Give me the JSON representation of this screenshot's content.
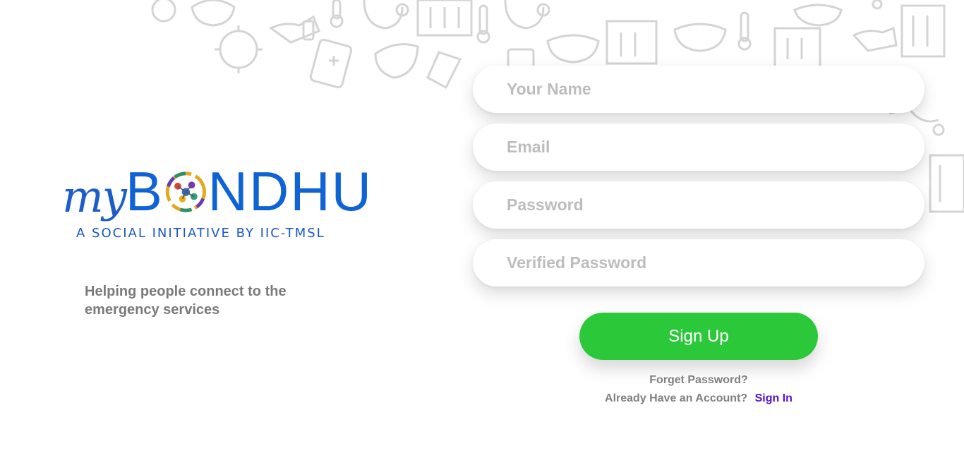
{
  "brand": {
    "logo_my": "my",
    "logo_b": "B",
    "logo_ndhu": "NDHU",
    "tagline": "A SOCIAL INITIATIVE BY IIC-TMSL",
    "subtitle": "Helping people connect to the emergency services",
    "colors": {
      "logo_blue": "#0f63d4",
      "tagline_blue": "#1958c7"
    }
  },
  "form": {
    "name_placeholder": "Your Name",
    "email_placeholder": "Email",
    "password_placeholder": "Password",
    "verify_placeholder": "Verified Password",
    "signup_label": "Sign Up",
    "forgot_label": "Forget Password?",
    "already_label": "Already Have an Account?",
    "signin_label": "Sign In"
  },
  "colors": {
    "signup_green": "#2bc83a",
    "signin_purple": "#5310d0",
    "placeholder_grey": "#bdbdbd"
  },
  "icons": [
    "virus-icon",
    "mask-icon",
    "thermometer-icon",
    "stethoscope-icon",
    "hospital-icon",
    "sanitizer-icon",
    "pill-bottle-icon",
    "logo-wheel-icon"
  ]
}
